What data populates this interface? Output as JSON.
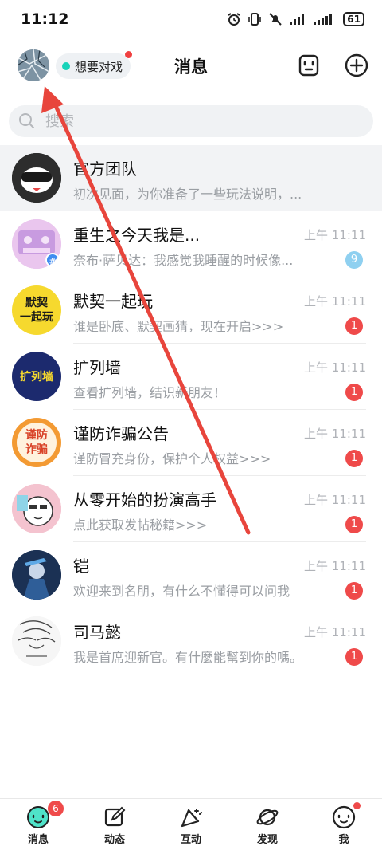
{
  "status_bar": {
    "time": "11:12",
    "battery": "61",
    "icons": [
      "alarm-icon",
      "vibrate-icon",
      "mute-icon",
      "signal-icon",
      "signal-icon",
      "battery-icon"
    ]
  },
  "header": {
    "title": "消息",
    "status_label": "想要对戏",
    "status_dot_color": "#18d3b9",
    "notification_dot_color": "#f04040"
  },
  "search": {
    "placeholder": "搜索"
  },
  "conversations": [
    {
      "name": "官方团队",
      "preview": "初次见面，为你准备了一些玩法说明，...",
      "time": "",
      "badge": "",
      "pinned": true
    },
    {
      "name": "重生之今天我是...",
      "preview": "奈布·萨贝达：我感觉我睡醒的时候像...",
      "time": "上午 11:11",
      "badge": "9"
    },
    {
      "name": "默契一起玩",
      "preview": "谁是卧底、默契画猜，现在开启>>>",
      "time": "上午 11:11",
      "badge": "1"
    },
    {
      "name": "扩列墙",
      "preview": "查看扩列墙，结识新朋友！",
      "time": "上午 11:11",
      "badge": "1"
    },
    {
      "name": "谨防诈骗公告",
      "preview": "谨防冒充身份，保护个人权益>>>",
      "time": "上午 11:11",
      "badge": "1"
    },
    {
      "name": "从零开始的扮演高手",
      "preview": "点此获取发帖秘籍>>>",
      "time": "上午 11:11",
      "badge": "1"
    },
    {
      "name": "铠",
      "preview": "欢迎来到名朋，有什么不懂得可以问我",
      "time": "上午 11:11",
      "badge": "1"
    },
    {
      "name": "司马懿",
      "preview": "我是首席迎新官。有什麼能幫到你的嗎。",
      "time": "上午 11:11",
      "badge": "1"
    }
  ],
  "avatar_text": {
    "moqi": "默契\n一起玩",
    "kuolie": "扩列墙",
    "jinfang": "谨防\n诈骗"
  },
  "tabbar": [
    {
      "label": "消息",
      "badge": "6",
      "icon": "message-icon"
    },
    {
      "label": "动态",
      "icon": "edit-icon"
    },
    {
      "label": "互动",
      "icon": "interact-icon"
    },
    {
      "label": "发现",
      "icon": "planet-icon"
    },
    {
      "label": "我",
      "icon": "profile-icon",
      "dot": true
    }
  ],
  "colors": {
    "accent": "#18d3b9",
    "badge_red": "#ef4a4a",
    "badge_blue": "#8fd0f0",
    "arrow_red": "#e8453c"
  }
}
